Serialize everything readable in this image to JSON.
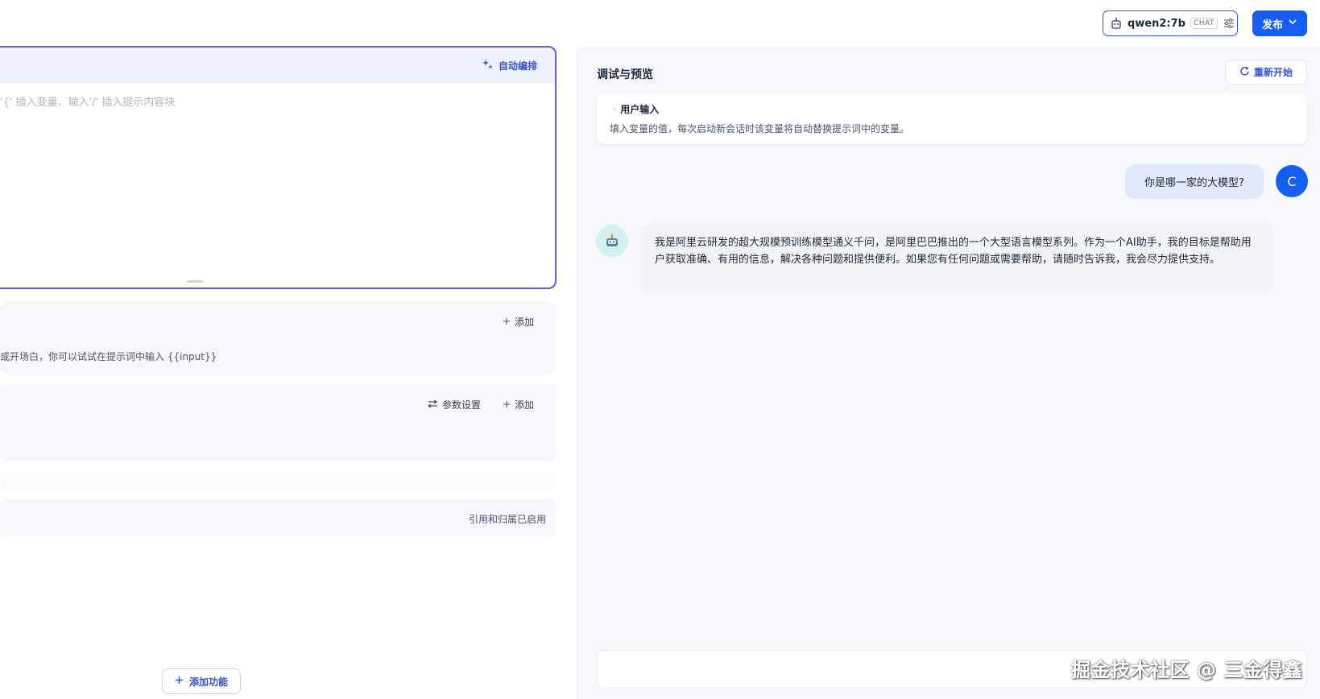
{
  "header": {
    "model_name": "qwen2:7b",
    "model_mode": "CHAT",
    "publish_label": "发布"
  },
  "prompt": {
    "auto_arrange_label": "自动编排",
    "placeholder": "'{' 插入变量、输入'/' 插入提示内容块"
  },
  "sections": {
    "variables": {
      "add_label": "添加",
      "hint": "或开场白，你可以试试在提示词中输入 {{input}}"
    },
    "context": {
      "params_label": "参数设置",
      "add_label": "添加"
    },
    "citation": {
      "status": "引用和归属已启用"
    }
  },
  "add_feature_label": "添加功能",
  "debug": {
    "title": "调试与预览",
    "restart_label": "重新开始",
    "user_input_title": "用户输入",
    "user_input_desc": "填入变量的值，每次启动新会话时该变量将自动替换提示词中的变量。"
  },
  "chat": {
    "user_message": "你是哪一家的大模型?",
    "user_avatar_letter": "C",
    "bot_message": "我是阿里云研发的超大规模预训练模型通义千问，是阿里巴巴推出的一个大型语言模型系列。作为一个AI助手，我的目标是帮助用户获取准确、有用的信息，解决各种问题和提供便利。如果您有任何问题或需要帮助，请随时告诉我，我会尽力提供支持。"
  },
  "watermark": "掘金技术社区 @ 三金得鑫",
  "colors": {
    "accent": "#155eef",
    "prompt_border": "#6d57d6",
    "link": "#3451c9"
  },
  "icons": [
    "robot-icon",
    "tune-icon",
    "chevron-down-icon",
    "sparkle-icon",
    "plus-icon",
    "sliders-icon",
    "refresh-icon",
    "chevron-right-icon"
  ]
}
